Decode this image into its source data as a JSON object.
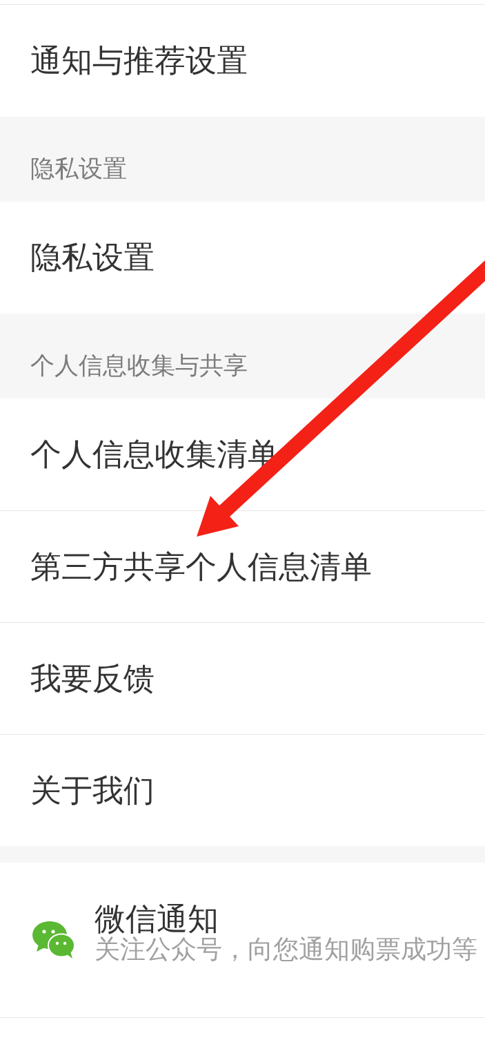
{
  "sections": [
    {
      "items": [
        "通知与推荐设置"
      ]
    },
    {
      "header": "隐私设置",
      "items": [
        "隐私设置"
      ]
    },
    {
      "header": "个人信息收集与共享",
      "items": [
        "个人信息收集清单",
        "第三方共享个人信息清单",
        "我要反馈",
        "关于我们"
      ]
    }
  ],
  "wechat_notice": {
    "title": "微信通知",
    "description": "关注公众号，向您通知购票成功等"
  }
}
